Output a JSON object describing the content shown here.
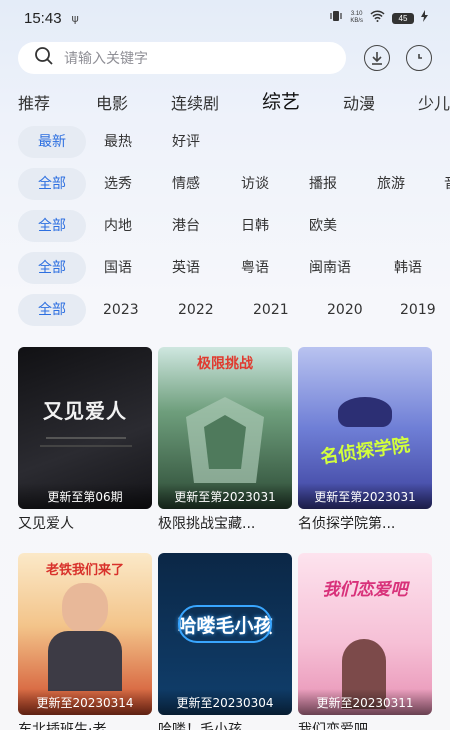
{
  "status": {
    "time": "15:43",
    "usb": "ψ",
    "net_speed_value": "3.10",
    "net_speed_unit": "KB/s",
    "battery": "45"
  },
  "search": {
    "placeholder": "请输入关键字"
  },
  "categories": [
    "推荐",
    "电影",
    "连续剧",
    "综艺",
    "动漫",
    "少儿"
  ],
  "active_category": "综艺",
  "filters": [
    [
      "最新",
      "最热",
      "好评"
    ],
    [
      "全部",
      "选秀",
      "情感",
      "访谈",
      "播报",
      "旅游",
      "音"
    ],
    [
      "全部",
      "内地",
      "港台",
      "日韩",
      "欧美"
    ],
    [
      "全部",
      "国语",
      "英语",
      "粤语",
      "闽南语",
      "韩语"
    ],
    [
      "全部",
      "2023",
      "2022",
      "2021",
      "2020",
      "2019"
    ]
  ],
  "cards": [
    {
      "title": "又见爱人",
      "badge": "更新至第06期",
      "art_text": "又见爱人",
      "colors": [
        "#1b1b1f",
        "#3a3a40"
      ]
    },
    {
      "title": "极限挑战宝藏...",
      "badge": "更新至第2023031",
      "art_text": "极限挑战",
      "colors": [
        "#2e5a3c",
        "#8fb79a"
      ]
    },
    {
      "title": "名侦探学院第...",
      "badge": "更新至第2023031",
      "art_text": "名侦探学院",
      "colors": [
        "#3f4fb0",
        "#9aa6e6"
      ]
    },
    {
      "title": "东北插班生·老...",
      "badge": "更新至20230314",
      "art_text": "老铁我们来了",
      "colors": [
        "#d84b2a",
        "#f7c77b"
      ]
    },
    {
      "title": "哈喽！毛小孩",
      "badge": "更新至20230304",
      "art_text": "哈喽毛小孩",
      "colors": [
        "#0c2c52",
        "#12497d"
      ]
    },
    {
      "title": "我们恋爱吧",
      "badge": "更新至20230311",
      "art_text": "我们恋爱吧",
      "colors": [
        "#f7cfe0",
        "#f2a9c6"
      ]
    }
  ]
}
